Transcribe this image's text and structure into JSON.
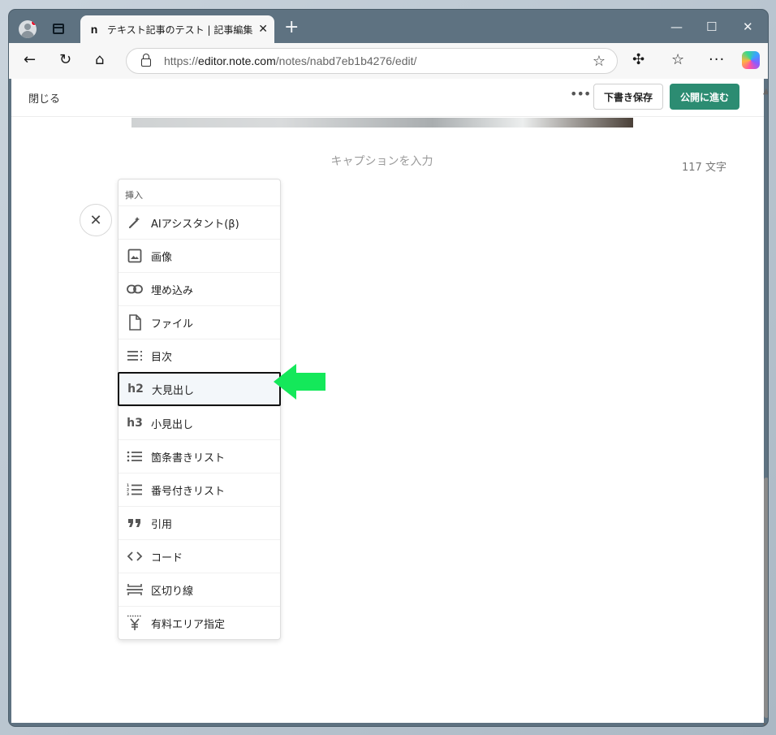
{
  "browser": {
    "tab_title": "テキスト記事のテスト | 記事編集 | note",
    "favicon_letter": "n",
    "url_prefix": "https://",
    "url_host": "editor.note.com",
    "url_path": "/notes/nabd7eb1b4276/edit/"
  },
  "editor": {
    "close_label": "閉じる",
    "more_label": "•••",
    "draft_button": "下書き保存",
    "publish_button": "公開に進む",
    "caption_placeholder": "キャプションを入力",
    "char_count": "117 文字"
  },
  "insert_menu": {
    "header": "挿入",
    "items": [
      {
        "label": "AIアシスタント(β)",
        "icon": "magic-wand-icon"
      },
      {
        "label": "画像",
        "icon": "image-icon"
      },
      {
        "label": "埋め込み",
        "icon": "link-icon"
      },
      {
        "label": "ファイル",
        "icon": "file-icon"
      },
      {
        "label": "目次",
        "icon": "toc-icon"
      },
      {
        "label": "大見出し",
        "icon": "h2-icon",
        "glyph": "h2"
      },
      {
        "label": "小見出し",
        "icon": "h3-icon",
        "glyph": "h3"
      },
      {
        "label": "箇条書きリスト",
        "icon": "bullet-list-icon"
      },
      {
        "label": "番号付きリスト",
        "icon": "numbered-list-icon"
      },
      {
        "label": "引用",
        "icon": "quote-icon"
      },
      {
        "label": "コード",
        "icon": "code-icon"
      },
      {
        "label": "区切り線",
        "icon": "divider-icon"
      },
      {
        "label": "有料エリア指定",
        "icon": "yen-icon"
      }
    ],
    "selected_index": 5
  },
  "colors": {
    "titlebar": "#5e7281",
    "publish": "#2c8c72",
    "arrow": "#14e85a"
  }
}
